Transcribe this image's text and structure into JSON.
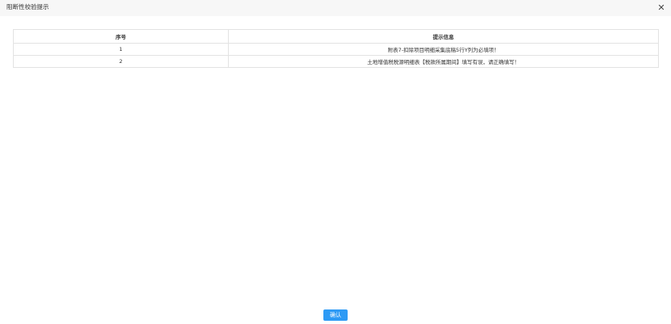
{
  "dialog": {
    "title": "阻断性校验提示",
    "close_glyph": "✕"
  },
  "table": {
    "headers": [
      "序号",
      "提示信息"
    ],
    "rows": [
      {
        "index": "1",
        "message": "附表7-扣除项目明细采集底稿5行Y列为必填项！"
      },
      {
        "index": "2",
        "message": "土地增值税税源明细表【税款所属期间】填写有误，请正确填写！"
      }
    ]
  },
  "footer": {
    "confirm_label": "确认"
  },
  "colors": {
    "accent": "#2d9af5",
    "titlebar_bg": "#f7f7f7",
    "border": "#e3e3e3"
  }
}
